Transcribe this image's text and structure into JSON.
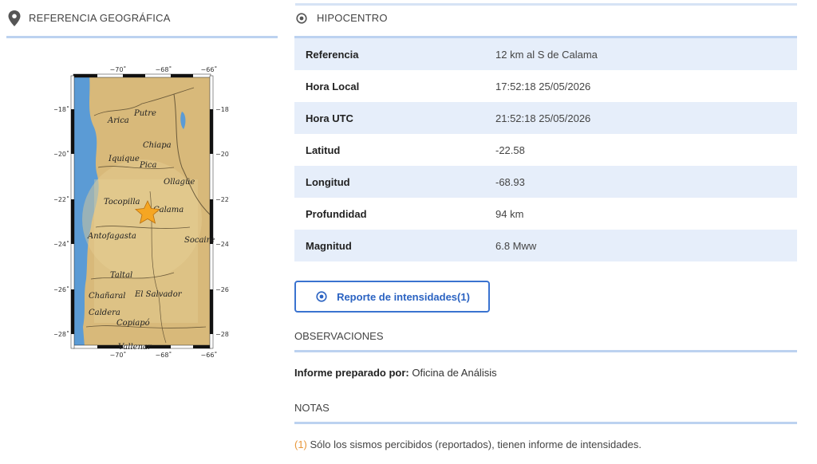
{
  "left_section": {
    "title": "REFERENCIA GEOGRÁFICA",
    "icon": "map-pin-icon"
  },
  "hypocenter": {
    "title": "HIPOCENTRO",
    "icon": "target-icon",
    "rows": [
      {
        "label": "Referencia",
        "value": "12 km al S de Calama"
      },
      {
        "label": "Hora Local",
        "value": "17:52:18 25/05/2026"
      },
      {
        "label": "Hora UTC",
        "value": "21:52:18 25/05/2026"
      },
      {
        "label": "Latitud",
        "value": "-22.58"
      },
      {
        "label": "Longitud",
        "value": "-68.93"
      },
      {
        "label": "Profundidad",
        "value": "94 km"
      },
      {
        "label": "Magnitud",
        "value": "6.8 Mww"
      }
    ]
  },
  "report_button": {
    "label": "Reporte de intensidades(1)"
  },
  "observations": {
    "title": "OBSERVACIONES",
    "prepared_label": "Informe preparado por:",
    "prepared_value": "Oficina de Análisis"
  },
  "notes": {
    "title": "NOTAS",
    "mark": "(1)",
    "text": "Sólo los sismos percibidos (reportados), tienen informe de intensidades."
  },
  "map": {
    "lon_ticks": [
      "−70˚",
      "−68˚",
      "−66˚"
    ],
    "lat_ticks": [
      "−18˚",
      "−20˚",
      "−22˚",
      "−24˚",
      "−26˚",
      "−28˚"
    ],
    "places": [
      "Arica",
      "Putre",
      "Chiapa",
      "Iquique",
      "Pica",
      "Ollagüe",
      "Tocopilla",
      "Calama",
      "Antofagasta",
      "Socaire",
      "Taltal",
      "Chañaral",
      "El Salvador",
      "Caldera",
      "Copiapó",
      "Vallenar"
    ],
    "colors": {
      "ocean": "#5b9bd5",
      "land": "#d8b97a",
      "marker": "#f5a623"
    }
  }
}
